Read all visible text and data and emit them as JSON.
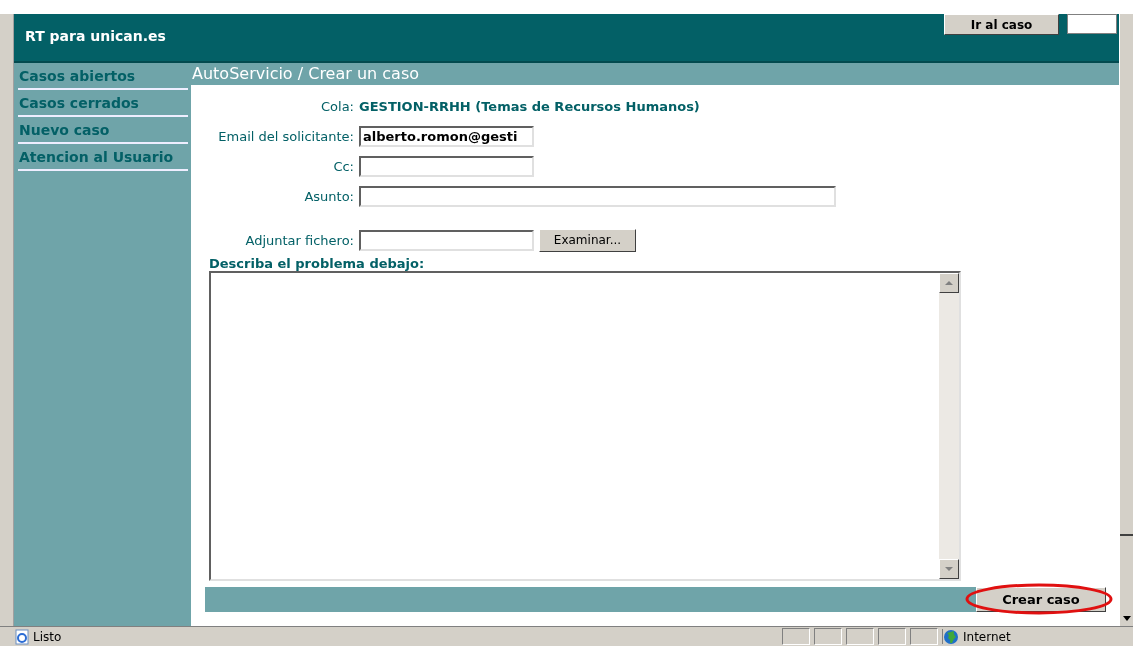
{
  "header": {
    "title": "RT para unican.es",
    "goto_button": "Ir al caso"
  },
  "sidebar": {
    "items": [
      {
        "label": "Casos abiertos"
      },
      {
        "label": "Casos cerrados"
      },
      {
        "label": "Nuevo caso"
      },
      {
        "label": "Atencion al Usuario"
      }
    ]
  },
  "page_title": "AutoServicio / Crear un caso",
  "form": {
    "queue_label": "Cola:",
    "queue_value": "GESTION-RRHH (Temas de Recursos Humanos)",
    "fields": [
      {
        "label": "Email del solicitante:",
        "value": "alberto.romon@gesti",
        "kind": "short"
      },
      {
        "label": "Cc:",
        "kind": "short"
      },
      {
        "label": "Asunto:",
        "kind": "long"
      },
      {
        "label": "Adjuntar fichero:",
        "kind": "file",
        "button": "Examinar..."
      }
    ],
    "description_label": "Describa el problema debajo:",
    "submit_button": "Crear caso"
  },
  "status_bar": {
    "text": "Listo",
    "zone": "Internet"
  }
}
